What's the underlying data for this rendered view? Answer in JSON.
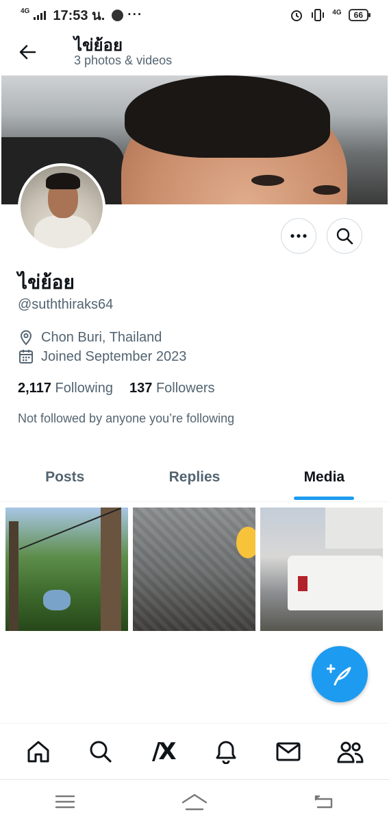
{
  "status_bar": {
    "network": "4G",
    "time": "17:53 น.",
    "dots": "···",
    "network_right": "4G",
    "battery": "66"
  },
  "header": {
    "name": "ไข่ย้อย",
    "subtitle": "3 photos & videos"
  },
  "profile": {
    "name": "ไข่ย้อย",
    "handle": "@suththiraks64",
    "location": "Chon Buri, Thailand",
    "joined": "Joined September 2023",
    "following_count": "2,117",
    "following_label": "Following",
    "followers_count": "137",
    "followers_label": "Followers",
    "not_followed_text": "Not followed by anyone you’re following"
  },
  "tabs": [
    {
      "label": "Posts",
      "active": false
    },
    {
      "label": "Replies",
      "active": false
    },
    {
      "label": "Media",
      "active": true
    }
  ],
  "media": [
    {
      "icon": "zipline-photo"
    },
    {
      "icon": "censored-photo"
    },
    {
      "icon": "pickup-truck-photo"
    }
  ],
  "bottom_nav": {
    "items": [
      "home-icon",
      "search-icon",
      "grok-icon",
      "notifications-icon",
      "messages-icon",
      "communities-icon"
    ],
    "grok_glyph": "/X"
  },
  "colors": {
    "accent": "#1d9bf0",
    "text_primary": "#0f1419",
    "text_secondary": "#536471"
  }
}
